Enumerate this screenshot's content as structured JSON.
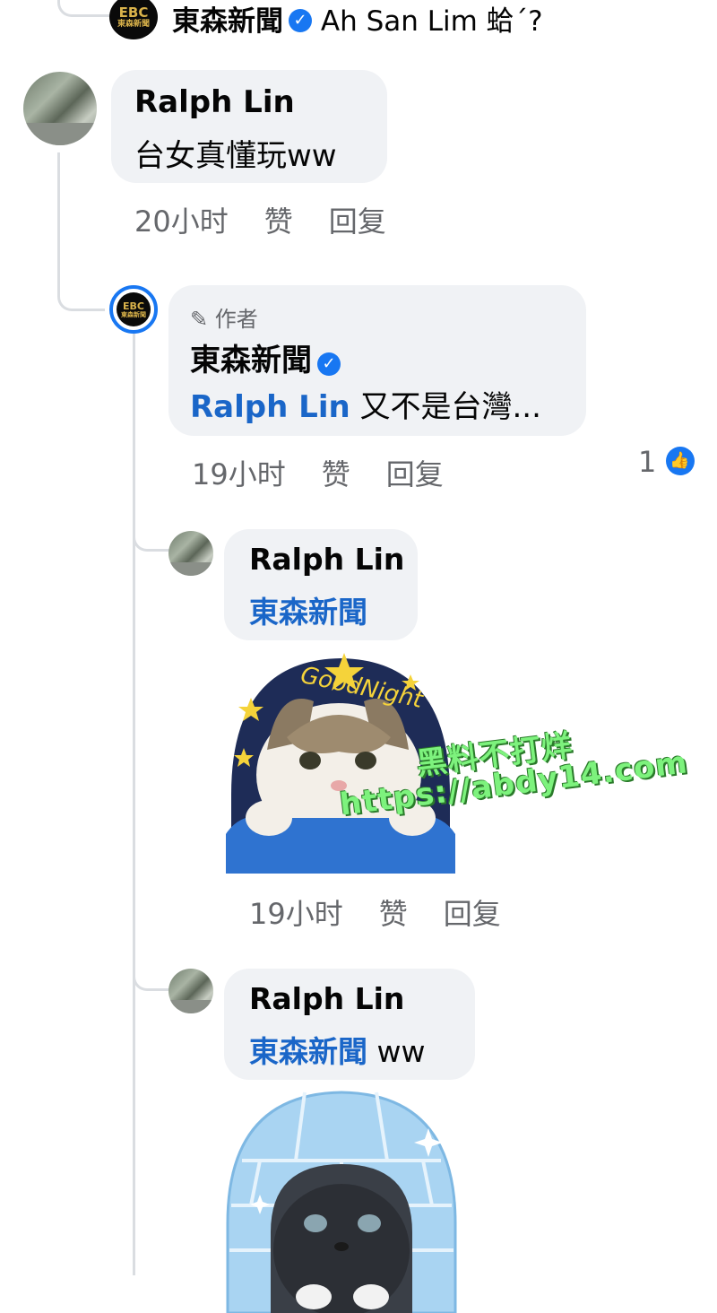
{
  "top_comment": {
    "author": "東森新聞",
    "text": "Ah San Lim 蛤´?"
  },
  "comment1": {
    "author": "Ralph Lin",
    "text": "台女真懂玩ww",
    "time": "20小时",
    "like_label": "赞",
    "reply_label": "回复"
  },
  "comment2": {
    "badge": "作者",
    "author": "東森新聞",
    "mention": "Ralph Lin",
    "text": "又不是台灣...",
    "time": "19小时",
    "like_label": "赞",
    "reply_label": "回复",
    "reaction_count": "1"
  },
  "comment3": {
    "author": "Ralph Lin",
    "mention": "東森新聞",
    "sticker_text": "GoodNight",
    "time": "19小时",
    "like_label": "赞",
    "reply_label": "回复"
  },
  "comment4": {
    "author": "Ralph Lin",
    "mention": "東森新聞",
    "text": "ww"
  },
  "logo": {
    "line1": "EBC",
    "line2": "東森新聞"
  },
  "watermark": {
    "line1": "黑料不打烊",
    "line2": "https://abdy14.com"
  },
  "colors": {
    "accent": "#1877f2",
    "mention": "#1a66c8",
    "bubble": "#f0f2f5",
    "muted": "#65676b"
  }
}
